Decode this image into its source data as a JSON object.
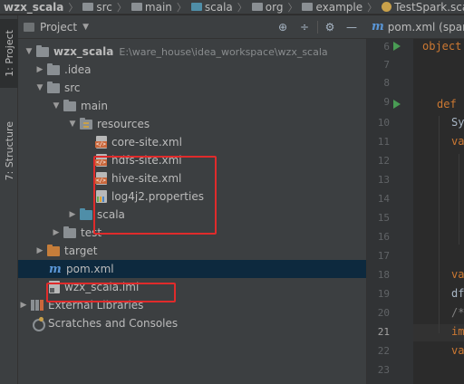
{
  "breadcrumb": [
    "wzx_scala",
    "src",
    "main",
    "scala",
    "org",
    "example",
    "TestSpark.scala"
  ],
  "toolstrip": {
    "project_tab": "1: Project",
    "structure_tab": "7: Structure"
  },
  "panel": {
    "title": "Project"
  },
  "tree": {
    "root_name": "wzx_scala",
    "root_path": "E:\\ware_house\\idea_workspace\\wzx_scala",
    "idea": ".idea",
    "src": "src",
    "main": "main",
    "resources": "resources",
    "files": [
      "core-site.xml",
      "hdfs-site.xml",
      "hive-site.xml",
      "log4j2.properties"
    ],
    "scala": "scala",
    "test": "test",
    "target": "target",
    "pom": "pom.xml",
    "iml": "wzx_scala.iml",
    "ext_libs": "External Libraries",
    "scratches": "Scratches and Consoles"
  },
  "editor": {
    "tab_label": "pom.xml (spar",
    "line_numbers": [
      "6",
      "7",
      "8",
      "9",
      "10",
      "11",
      "12",
      "13",
      "14",
      "15",
      "16",
      "17",
      "18",
      "19",
      "20",
      "21",
      "22",
      "23"
    ],
    "code_lines": {
      "l6": "object",
      "l9": "def",
      "l10": "Sy",
      "l11": "va",
      "l18": "va",
      "l19": "df",
      "l20": "/*",
      "l21": "im",
      "l22": "va"
    }
  }
}
